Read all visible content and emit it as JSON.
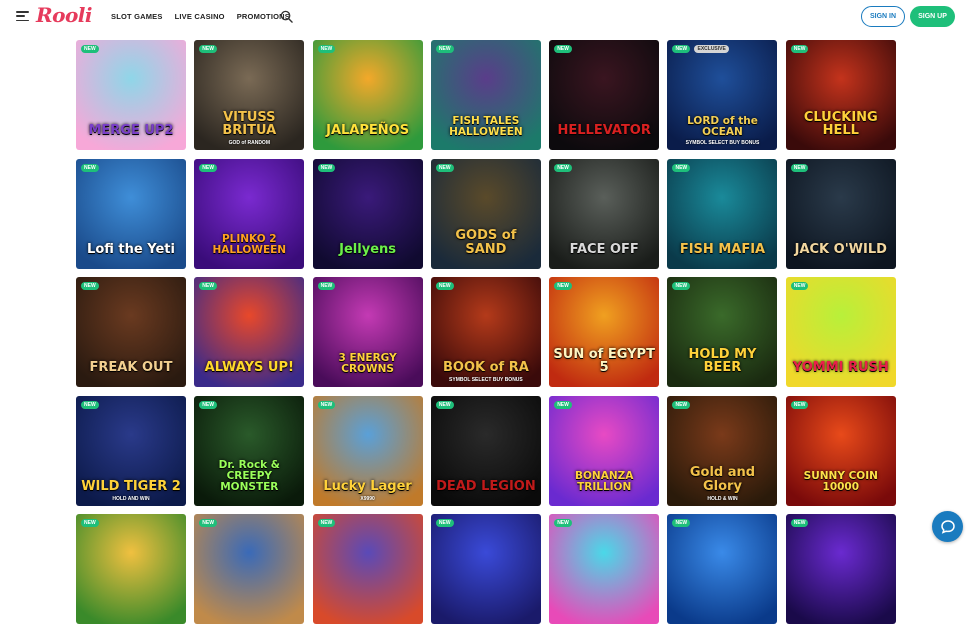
{
  "header": {
    "logo": "Rooli",
    "nav": [
      "SLOT GAMES",
      "LIVE CASINO",
      "PROMOTIONS"
    ],
    "sign_in": "SIGN IN",
    "sign_up": "SIGN UP"
  },
  "badges": {
    "new": "NEW",
    "exclusive": "EXCLUSIVE"
  },
  "colors": {
    "brand": "#e63b5c",
    "accent_green": "#1ebf7a",
    "accent_blue": "#1a7bbf"
  },
  "games": [
    {
      "title": "MERGE UP2",
      "badge": "NEW",
      "bg": "#8fd6e8,#f7a8d8",
      "color": "#7a3fc9"
    },
    {
      "title": "VITUSS BRITUA",
      "sub": "GOD of RANDOM",
      "badge": "NEW",
      "bg": "#7a6a55,#2b2620",
      "color": "#f4c24a"
    },
    {
      "title": "JALAPEÑOS",
      "badge": "NEW",
      "bg": "#f3a82a,#2e9a3c",
      "color": "#ffe23b"
    },
    {
      "title": "FISH TALES HALLOWEEN",
      "badge": "NEW",
      "bg": "#5a3d8a,#1c7a6a",
      "color": "#ffdf4a"
    },
    {
      "title": "HELLEVATOR",
      "badge": "NEW",
      "bg": "#3a1520,#0c0a0d",
      "color": "#d92020"
    },
    {
      "title": "LORD of the OCEAN",
      "sub": "SYMBOL SELECT BUY BONUS",
      "badge": "NEW",
      "badge2": "EXCLUSIVE",
      "bg": "#1f4f9a,#0a1c4a",
      "color": "#f2cf55"
    },
    {
      "title": "CLUCKING HELL",
      "badge": "NEW",
      "bg": "#c4331c,#3a0a0a",
      "color": "#ffd13a"
    },
    {
      "title": "Lofi the Yeti",
      "badge": "NEW",
      "bg": "#3f8ed8,#1a4a8a",
      "color": "#ffffff"
    },
    {
      "title": "PLINKO 2 HALLOWEEN",
      "badge": "NEW",
      "bg": "#7a2ad0,#3a0c7a",
      "color": "#ffa020"
    },
    {
      "title": "Jellyens",
      "badge": "NEW",
      "bg": "#3a1a7a,#100a30",
      "color": "#6cf04a"
    },
    {
      "title": "GODS of SAND",
      "badge": "NEW",
      "bg": "#5a4a2a,#1a2a3a",
      "color": "#f3c24a"
    },
    {
      "title": "FACE OFF",
      "badge": "NEW",
      "bg": "#5a5f5a,#1a1d1a",
      "color": "#d9d9d9"
    },
    {
      "title": "FISH MAFIA",
      "badge": "NEW",
      "bg": "#1a8a9a,#0a3a4a",
      "color": "#f4c24a"
    },
    {
      "title": "JACK O'WILD",
      "badge": "NEW",
      "bg": "#2a3a4a,#0d1520",
      "color": "#f2d7a0"
    },
    {
      "title": "FREAK OUT",
      "badge": "NEW",
      "bg": "#6a3a20,#2a1a10",
      "color": "#f3d090"
    },
    {
      "title": "ALWAYS UP!",
      "badge": "NEW",
      "bg": "#e8482a,#3a2a8a",
      "color": "#ffd82a"
    },
    {
      "title": "3 ENERGY CROWNS",
      "badge": "NEW",
      "bg": "#c43ab4,#4a0c5a",
      "color": "#ffd23a"
    },
    {
      "title": "BOOK of RA",
      "sub": "SYMBOL SELECT BUY BONUS",
      "badge": "NEW",
      "bg": "#b43a1a,#3a0a0a",
      "color": "#f3c24a"
    },
    {
      "title": "SUN of EGYPT 5",
      "badge": "NEW",
      "bg": "#f0a020,#c02a10",
      "color": "#fff4c0"
    },
    {
      "title": "HOLD MY BEER",
      "badge": "NEW",
      "bg": "#3a6a2a,#1a2a10",
      "color": "#ffd23a"
    },
    {
      "title": "YOMMI RUSH",
      "badge": "NEW",
      "bg": "#b8f03a,#f0d82a",
      "color": "#e8204a"
    },
    {
      "title": "WILD TIGER 2",
      "sub": "HOLD AND WIN",
      "badge": "NEW",
      "bg": "#2a3a8a,#0c1a4a",
      "color": "#ffd23a"
    },
    {
      "title": "Dr. Rock & CREEPY MONSTER",
      "badge": "NEW",
      "bg": "#2a5a2a,#0a1a0a",
      "color": "#9aff5a"
    },
    {
      "title": "Lucky Lager",
      "sub": "X9990",
      "badge": "NEW",
      "bg": "#5aa0d8,#c07a2a",
      "color": "#ffd23a"
    },
    {
      "title": "DEAD LEGION",
      "badge": "NEW",
      "bg": "#2a2a2a,#0a0a0a",
      "color": "#c01a1a"
    },
    {
      "title": "BONANZA TRILLION",
      "badge": "NEW",
      "bg": "#e84ac4,#6a2ad0",
      "color": "#ffd23a"
    },
    {
      "title": "Gold and Glory",
      "sub": "HOLD & WIN",
      "badge": "NEW",
      "bg": "#7a3a1a,#2a1a0a",
      "color": "#f3c24a"
    },
    {
      "title": "SUNNY COIN 10000",
      "badge": "NEW",
      "bg": "#e84a1a,#7a0a0a",
      "color": "#ffe24a"
    },
    {
      "title": "",
      "badge": "NEW",
      "bg": "#f0c040,#3a8a2a",
      "color": "#fff"
    },
    {
      "title": "",
      "badge": "NEW",
      "bg": "#3a6ab8,#c08a4a",
      "color": "#fff"
    },
    {
      "title": "",
      "badge": "NEW",
      "bg": "#5a4ab8,#d84a2a",
      "color": "#fff"
    },
    {
      "title": "",
      "badge": "NEW",
      "bg": "#3a4ad8,#1a1a6a",
      "color": "#fff"
    },
    {
      "title": "",
      "badge": "NEW",
      "bg": "#4ad8e8,#e84ab8",
      "color": "#fff"
    },
    {
      "title": "",
      "badge": "NEW",
      "bg": "#3a8ae8,#0a3a8a",
      "color": "#fff"
    },
    {
      "title": "",
      "badge": "NEW",
      "bg": "#6a2ad0,#1a0a4a",
      "color": "#fff"
    }
  ]
}
